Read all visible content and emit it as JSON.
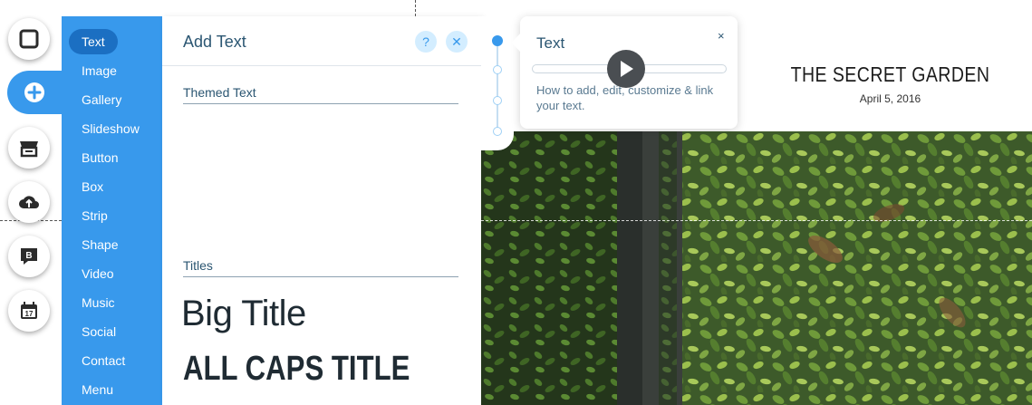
{
  "tool_rail": {
    "items": [
      {
        "name": "background",
        "icon": "square-icon"
      },
      {
        "name": "add",
        "icon": "plus-icon",
        "active": true
      },
      {
        "name": "app-market",
        "icon": "store-icon"
      },
      {
        "name": "upload",
        "icon": "cloud-upload-icon"
      },
      {
        "name": "blog",
        "icon": "blog-b-icon",
        "letter": "B"
      },
      {
        "name": "bookings",
        "icon": "calendar-icon",
        "day": "17"
      }
    ]
  },
  "categories": {
    "items": [
      {
        "label": "Text",
        "selected": true
      },
      {
        "label": "Image"
      },
      {
        "label": "Gallery"
      },
      {
        "label": "Slideshow"
      },
      {
        "label": "Button"
      },
      {
        "label": "Box"
      },
      {
        "label": "Strip"
      },
      {
        "label": "Shape"
      },
      {
        "label": "Video"
      },
      {
        "label": "Music"
      },
      {
        "label": "Social"
      },
      {
        "label": "Contact"
      },
      {
        "label": "Menu"
      }
    ]
  },
  "add_panel": {
    "title": "Add Text",
    "help_label": "?",
    "close_label": "✕",
    "sections": {
      "themed": "Themed Text",
      "titles": "Titles"
    },
    "presets": {
      "big_title": "Big Title",
      "caps_title": "ALL CAPS TITLE"
    }
  },
  "tooltip": {
    "title": "Text",
    "close_label": "×",
    "text": "How to add, edit, customize & link your text."
  },
  "site": {
    "title": "THE SECRET GARDEN",
    "date": "April 5, 2016"
  },
  "colors": {
    "accent": "#3899ec",
    "selected": "#1b6fc2",
    "panel_text": "#2b5672"
  }
}
